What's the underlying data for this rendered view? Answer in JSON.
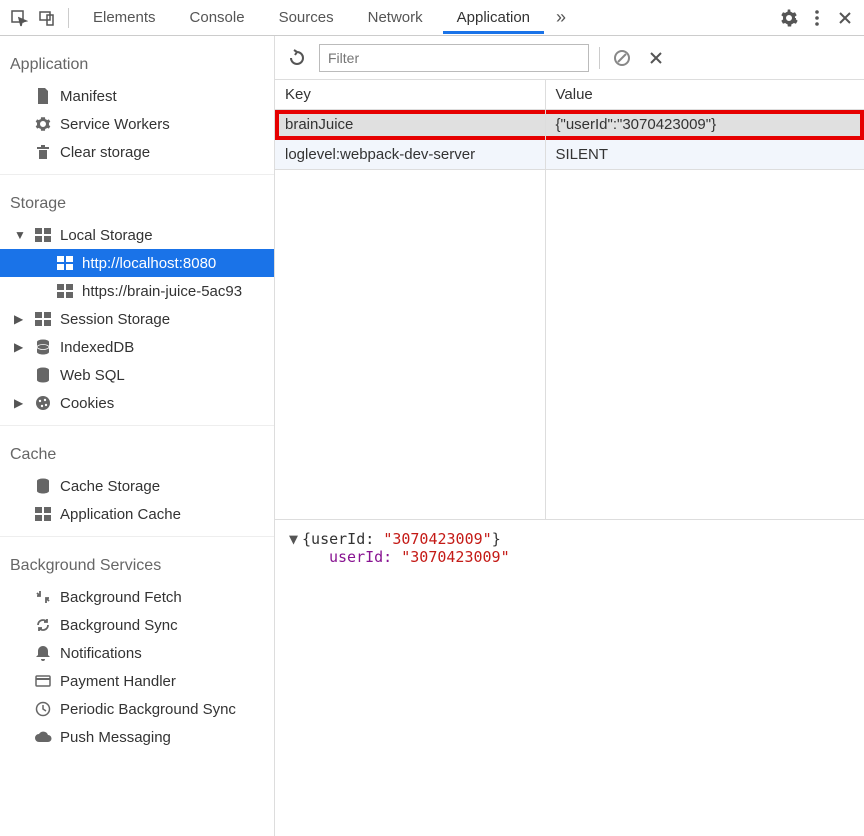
{
  "tabs": {
    "elements": "Elements",
    "console": "Console",
    "sources": "Sources",
    "network": "Network",
    "application": "Application"
  },
  "sidebar": {
    "application": {
      "title": "Application",
      "manifest": "Manifest",
      "service_workers": "Service Workers",
      "clear_storage": "Clear storage"
    },
    "storage": {
      "title": "Storage",
      "local_storage": "Local Storage",
      "ls_host1": "http://localhost:8080",
      "ls_host2": "https://brain-juice-5ac93",
      "session_storage": "Session Storage",
      "indexeddb": "IndexedDB",
      "websql": "Web SQL",
      "cookies": "Cookies"
    },
    "cache": {
      "title": "Cache",
      "cache_storage": "Cache Storage",
      "app_cache": "Application Cache"
    },
    "bg": {
      "title": "Background Services",
      "fetch": "Background Fetch",
      "sync": "Background Sync",
      "notifications": "Notifications",
      "payment": "Payment Handler",
      "periodic": "Periodic Background Sync",
      "push": "Push Messaging"
    }
  },
  "filter": {
    "placeholder": "Filter"
  },
  "table": {
    "headers": {
      "key": "Key",
      "value": "Value"
    },
    "row0": {
      "key": "brainJuice",
      "value": "{\"userId\":\"3070423009\"}"
    },
    "row1": {
      "key": "loglevel:webpack-dev-server",
      "value": "SILENT"
    }
  },
  "detail": {
    "open": "{userId: ",
    "val": "\"3070423009\"",
    "close": "}",
    "key": "userId: "
  }
}
